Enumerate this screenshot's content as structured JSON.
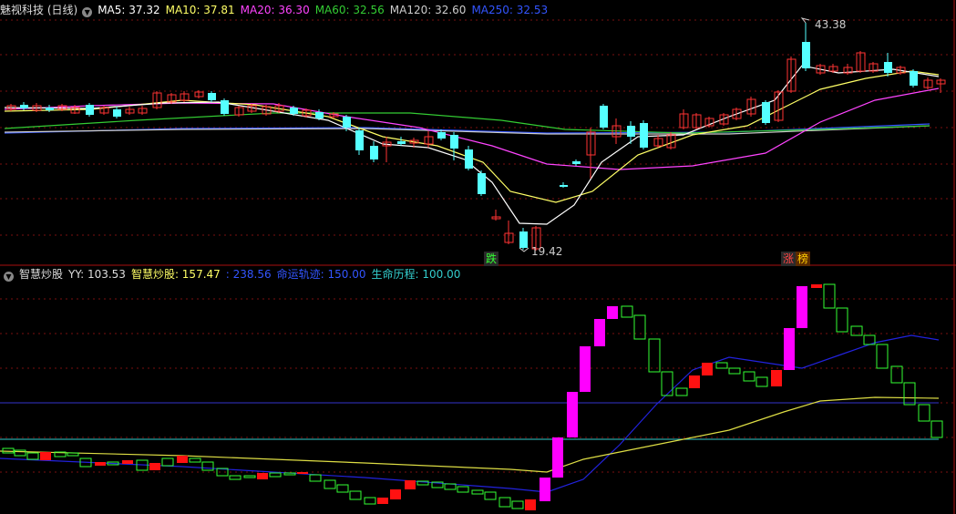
{
  "window": {
    "title": "魅视科技 (日线)",
    "ma_legend": [
      {
        "label": "MA5: 37.32",
        "color": "#ffffff"
      },
      {
        "label": "MA10: 37.81",
        "color": "#ffff66"
      },
      {
        "label": "MA20: 36.30",
        "color": "#ff44ff"
      },
      {
        "label": "MA60: 32.56",
        "color": "#33cc33"
      },
      {
        "label": "MA120: 32.60",
        "color": "#cccccc"
      },
      {
        "label": "MA250: 32.53",
        "color": "#3355ff"
      }
    ],
    "high_label": "43.38",
    "low_label": "19.42",
    "badge_die": "跌",
    "badge_zhang": "涨",
    "badge_bang": "榜"
  },
  "indicator": {
    "title": "智慧炒股",
    "legend": [
      {
        "label": "YY: 103.53",
        "color": "#dddddd"
      },
      {
        "label": "智慧炒股: 157.47",
        "color": "#ffff66"
      },
      {
        "label": ": 238.56",
        "color": "#3355ff"
      },
      {
        "label": "命运轨迹: 150.00",
        "color": "#3355ff"
      },
      {
        "label": "生命历程: 100.00",
        "color": "#33cccc"
      }
    ]
  },
  "colors": {
    "up": "#ff3333",
    "down": "#55ffff",
    "ind_green": "#33ff33",
    "ind_red": "#ff1111",
    "ind_magenta": "#ff00ff"
  }
}
